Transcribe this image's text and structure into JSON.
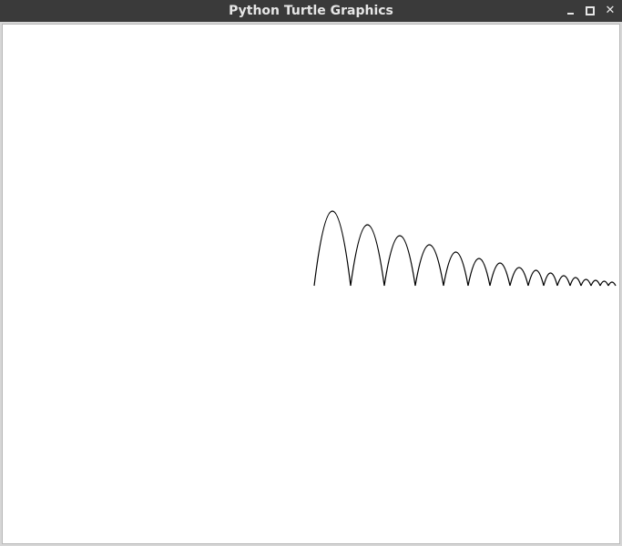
{
  "window": {
    "title": "Python Turtle Graphics",
    "controls": {
      "minimize_icon": "minimize-icon",
      "maximize_icon": "maximize-icon",
      "close_icon": "close-icon",
      "close_glyph": "✕"
    }
  },
  "canvas": {
    "background": "#ffffff",
    "stroke": "#000000"
  },
  "drawing": {
    "arcs": [
      {
        "w": 40,
        "h": 82
      },
      {
        "w": 37,
        "h": 67
      },
      {
        "w": 34,
        "h": 55
      },
      {
        "w": 31,
        "h": 45
      },
      {
        "w": 27,
        "h": 37
      },
      {
        "w": 24,
        "h": 30
      },
      {
        "w": 22,
        "h": 25
      },
      {
        "w": 20,
        "h": 20
      },
      {
        "w": 17,
        "h": 17
      },
      {
        "w": 15,
        "h": 14
      },
      {
        "w": 14,
        "h": 11
      },
      {
        "w": 12,
        "h": 9
      },
      {
        "w": 11,
        "h": 7
      },
      {
        "w": 10,
        "h": 6
      },
      {
        "w": 9,
        "h": 5
      },
      {
        "w": 8,
        "h": 4
      }
    ]
  }
}
